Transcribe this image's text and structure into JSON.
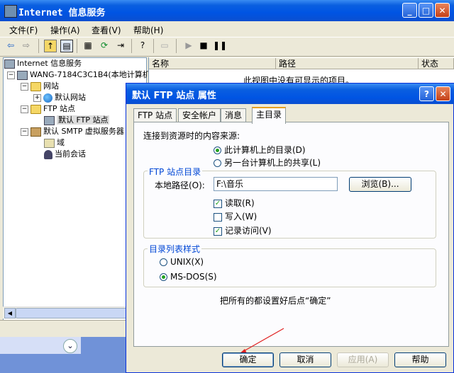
{
  "main": {
    "title": "Internet 信息服务",
    "menu": [
      "文件(F)",
      "操作(A)",
      "查看(V)",
      "帮助(H)"
    ],
    "columns": [
      "名称",
      "路径",
      "状态"
    ],
    "empty_message": "此视图中没有可显示的项目。"
  },
  "tree": {
    "root": "Internet 信息服务",
    "computer": "WANG-7184C3C1B4(本地计算机",
    "websites": "网站",
    "default_website": "默认网站",
    "ftp_sites": "FTP 站点",
    "default_ftp": "默认 FTP 站点",
    "smtp": "默认 SMTP 虚拟服务器",
    "domains": "域",
    "sessions": "当前会话"
  },
  "dialog": {
    "title": "默认 FTP 站点 属性",
    "tabs": [
      "FTP 站点",
      "安全帐户",
      "消息",
      "主目录"
    ],
    "source_label": "连接到资源时的内容来源:",
    "radio_local": "此计算机上的目录(D)",
    "radio_share": "另一台计算机上的共享(L)",
    "ftp_dir_group": "FTP 站点目录",
    "local_path_label": "本地路径(O):",
    "local_path_value": "F:\\音乐",
    "browse_button": "浏览(B)...",
    "read_label": "读取(R)",
    "write_label": "写入(W)",
    "log_label": "记录访问(V)",
    "listing_group": "目录列表样式",
    "unix_label": "UNIX(X)",
    "msdos_label": "MS-DOS(S)",
    "hint": "把所有的都设置好后点“确定”",
    "ok": "确定",
    "cancel": "取消",
    "apply": "应用(A)",
    "help": "帮助"
  },
  "colors": {
    "title_blue": "#0054e3",
    "arrow_red": "#e02020",
    "radio_green": "#21a121"
  }
}
